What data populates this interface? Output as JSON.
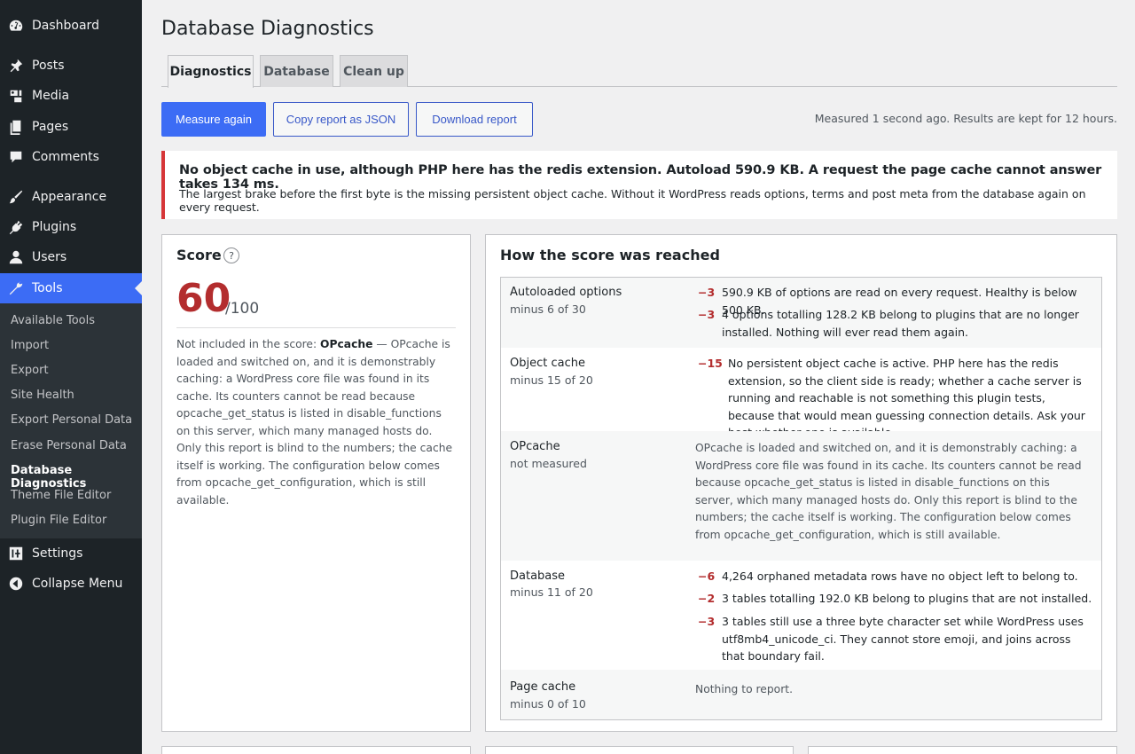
{
  "sidebar": {
    "items": [
      {
        "label": "Dashboard",
        "icon": "dashboard-icon"
      },
      {
        "label": "Posts",
        "icon": "pushpin-icon"
      },
      {
        "label": "Media",
        "icon": "media-icon"
      },
      {
        "label": "Pages",
        "icon": "pages-icon"
      },
      {
        "label": "Comments",
        "icon": "comment-icon"
      },
      {
        "label": "Appearance",
        "icon": "paintbrush-icon"
      },
      {
        "label": "Plugins",
        "icon": "plugin-icon"
      },
      {
        "label": "Users",
        "icon": "user-icon"
      },
      {
        "label": "Tools",
        "icon": "wrench-icon"
      },
      {
        "label": "Settings",
        "icon": "settings-sliders-icon"
      },
      {
        "label": "Collapse Menu",
        "icon": "collapse-icon"
      }
    ],
    "submenu": [
      "Available Tools",
      "Import",
      "Export",
      "Site Health",
      "Export Personal Data",
      "Erase Personal Data",
      "Database Diagnostics",
      "Theme File Editor",
      "Plugin File Editor"
    ]
  },
  "page": {
    "title": "Database Diagnostics",
    "tabs": [
      "Diagnostics",
      "Database",
      "Clean up"
    ],
    "buttons": {
      "measure": "Measure again",
      "copy": "Copy report as JSON",
      "download": "Download report"
    },
    "measured_note": "Measured 1 second ago. Results are kept for 12 hours."
  },
  "notice": {
    "title": "No object cache in use, although PHP here has the redis extension. Autoload 590.9 KB. A request the page cache cannot answer takes 134 ms.",
    "body": "The largest brake before the first byte is the missing persistent object cache. Without it WordPress reads options, terms and post meta from the database again on every request."
  },
  "score": {
    "title": "Score",
    "help": "?",
    "value": "60",
    "max": "/100",
    "note_lead": "Not included in the score: ",
    "note_bold": "OPcache",
    "note_rest": " — OPcache is loaded and switched on, and it is demonstrably caching: a WordPress core file was found in its cache. Its counters cannot be read because opcache_get_status is listed in disable_functions on this server, which many managed hosts do. Only this report is blind to the numbers; the cache itself is working. The configuration below comes from opcache_get_configuration, which is still available."
  },
  "breakdown": {
    "title": "How the score was reached",
    "rows": [
      {
        "label": "Autoloaded options",
        "sub": "minus 6 of 30",
        "items": [
          {
            "pen": "−3",
            "text": "590.9 KB of options are read on every request. Healthy is below 500 KB."
          },
          {
            "pen": "−3",
            "text": "4 options totalling 128.2 KB belong to plugins that are no longer installed. Nothing will ever read them again."
          }
        ]
      },
      {
        "label": "Object cache",
        "sub": "minus 15 of 20",
        "items": [
          {
            "pen": "−15",
            "text": "No persistent object cache is active. PHP here has the redis extension, so the client side is ready; whether a cache server is running and reachable is not something this plugin tests, because that would mean guessing connection details. Ask your host whether one is available."
          }
        ]
      },
      {
        "label": "OPcache",
        "sub": "not measured",
        "text": "OPcache is loaded and switched on, and it is demonstrably caching: a WordPress core file was found in its cache. Its counters cannot be read because opcache_get_status is listed in disable_functions on this server, which many managed hosts do. Only this report is blind to the numbers; the cache itself is working. The configuration below comes from opcache_get_configuration, which is still available."
      },
      {
        "label": "Database",
        "sub": "minus 11 of 20",
        "items": [
          {
            "pen": "−6",
            "text": "4,264 orphaned metadata rows have no object left to belong to."
          },
          {
            "pen": "−2",
            "text": "3 tables totalling 192.0 KB belong to plugins that are not installed."
          },
          {
            "pen": "−3",
            "text": "3 tables still use a three byte character set while WordPress uses utf8mb4_unicode_ci. They cannot store emoji, and joins across that boundary fail."
          }
        ]
      },
      {
        "label": "Page cache",
        "sub": "minus 0 of 10",
        "text": "Nothing to report."
      }
    ]
  },
  "colors": {
    "sidebar_bg": "#1d2327",
    "accent": "#3c6cf5",
    "error": "#d63638",
    "penalty": "#b32d2e"
  }
}
